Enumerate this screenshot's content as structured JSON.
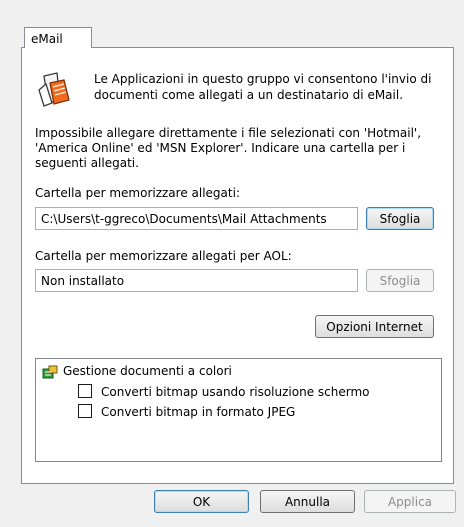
{
  "tab": {
    "label": "eMail"
  },
  "info": {
    "icon": "email-apps-icon",
    "text": "Le Applicazioni in questo gruppo vi consentono l'invio di documenti come allegati a un destinatario di eMail."
  },
  "description": "Impossibile allegare direttamente i file selezionati con 'Hotmail', 'America Online' ed 'MSN Explorer'. Indicare una cartella per i seguenti allegati.",
  "attachments": {
    "label": "Cartella per memorizzare allegati:",
    "value": "C:\\Users\\t-ggreco\\Documents\\Mail Attachments",
    "browse_label": "Sfoglia"
  },
  "aol": {
    "label": "Cartella per memorizzare allegati per AOL:",
    "value": "Non installato",
    "browse_label": "Sfoglia"
  },
  "internet_options_label": "Opzioni Internet",
  "color_docs": {
    "icon": "color-document-icon",
    "title": "Gestione documenti a colori",
    "options": [
      {
        "label": "Converti bitmap usando risoluzione schermo",
        "checked": false
      },
      {
        "label": "Converti bitmap in formato JPEG",
        "checked": false
      }
    ]
  },
  "footer": {
    "ok_label": "OK",
    "cancel_label": "Annulla",
    "apply_label": "Applica"
  }
}
